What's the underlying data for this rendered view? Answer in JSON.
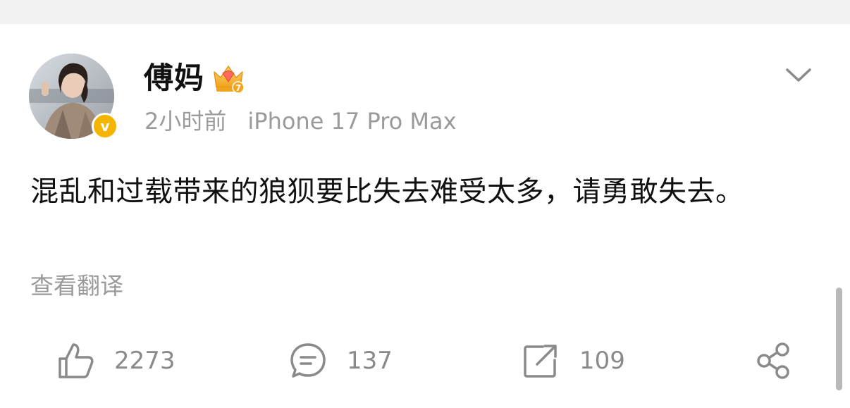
{
  "user": {
    "name": "傅妈",
    "time": "2小时前",
    "device": "iPhone 17 Pro Max",
    "badge_level": "7",
    "verified_mark": "v"
  },
  "post": {
    "text": "混乱和过载带来的狼狈要比失去难受太多，请勇敢失去。",
    "translate_label": "查看翻译"
  },
  "actions": {
    "likes": "2273",
    "comments": "137",
    "reposts": "109"
  },
  "colors": {
    "verified": "#f5b400",
    "muted_text": "#9a9a9a",
    "icon": "#8a8a8a"
  },
  "icons": {
    "like": "thumbs-up-icon",
    "comment": "comment-bubble-icon",
    "repost": "repost-icon",
    "share": "share-icon",
    "more": "chevron-down-icon",
    "level": "crown-icon"
  }
}
